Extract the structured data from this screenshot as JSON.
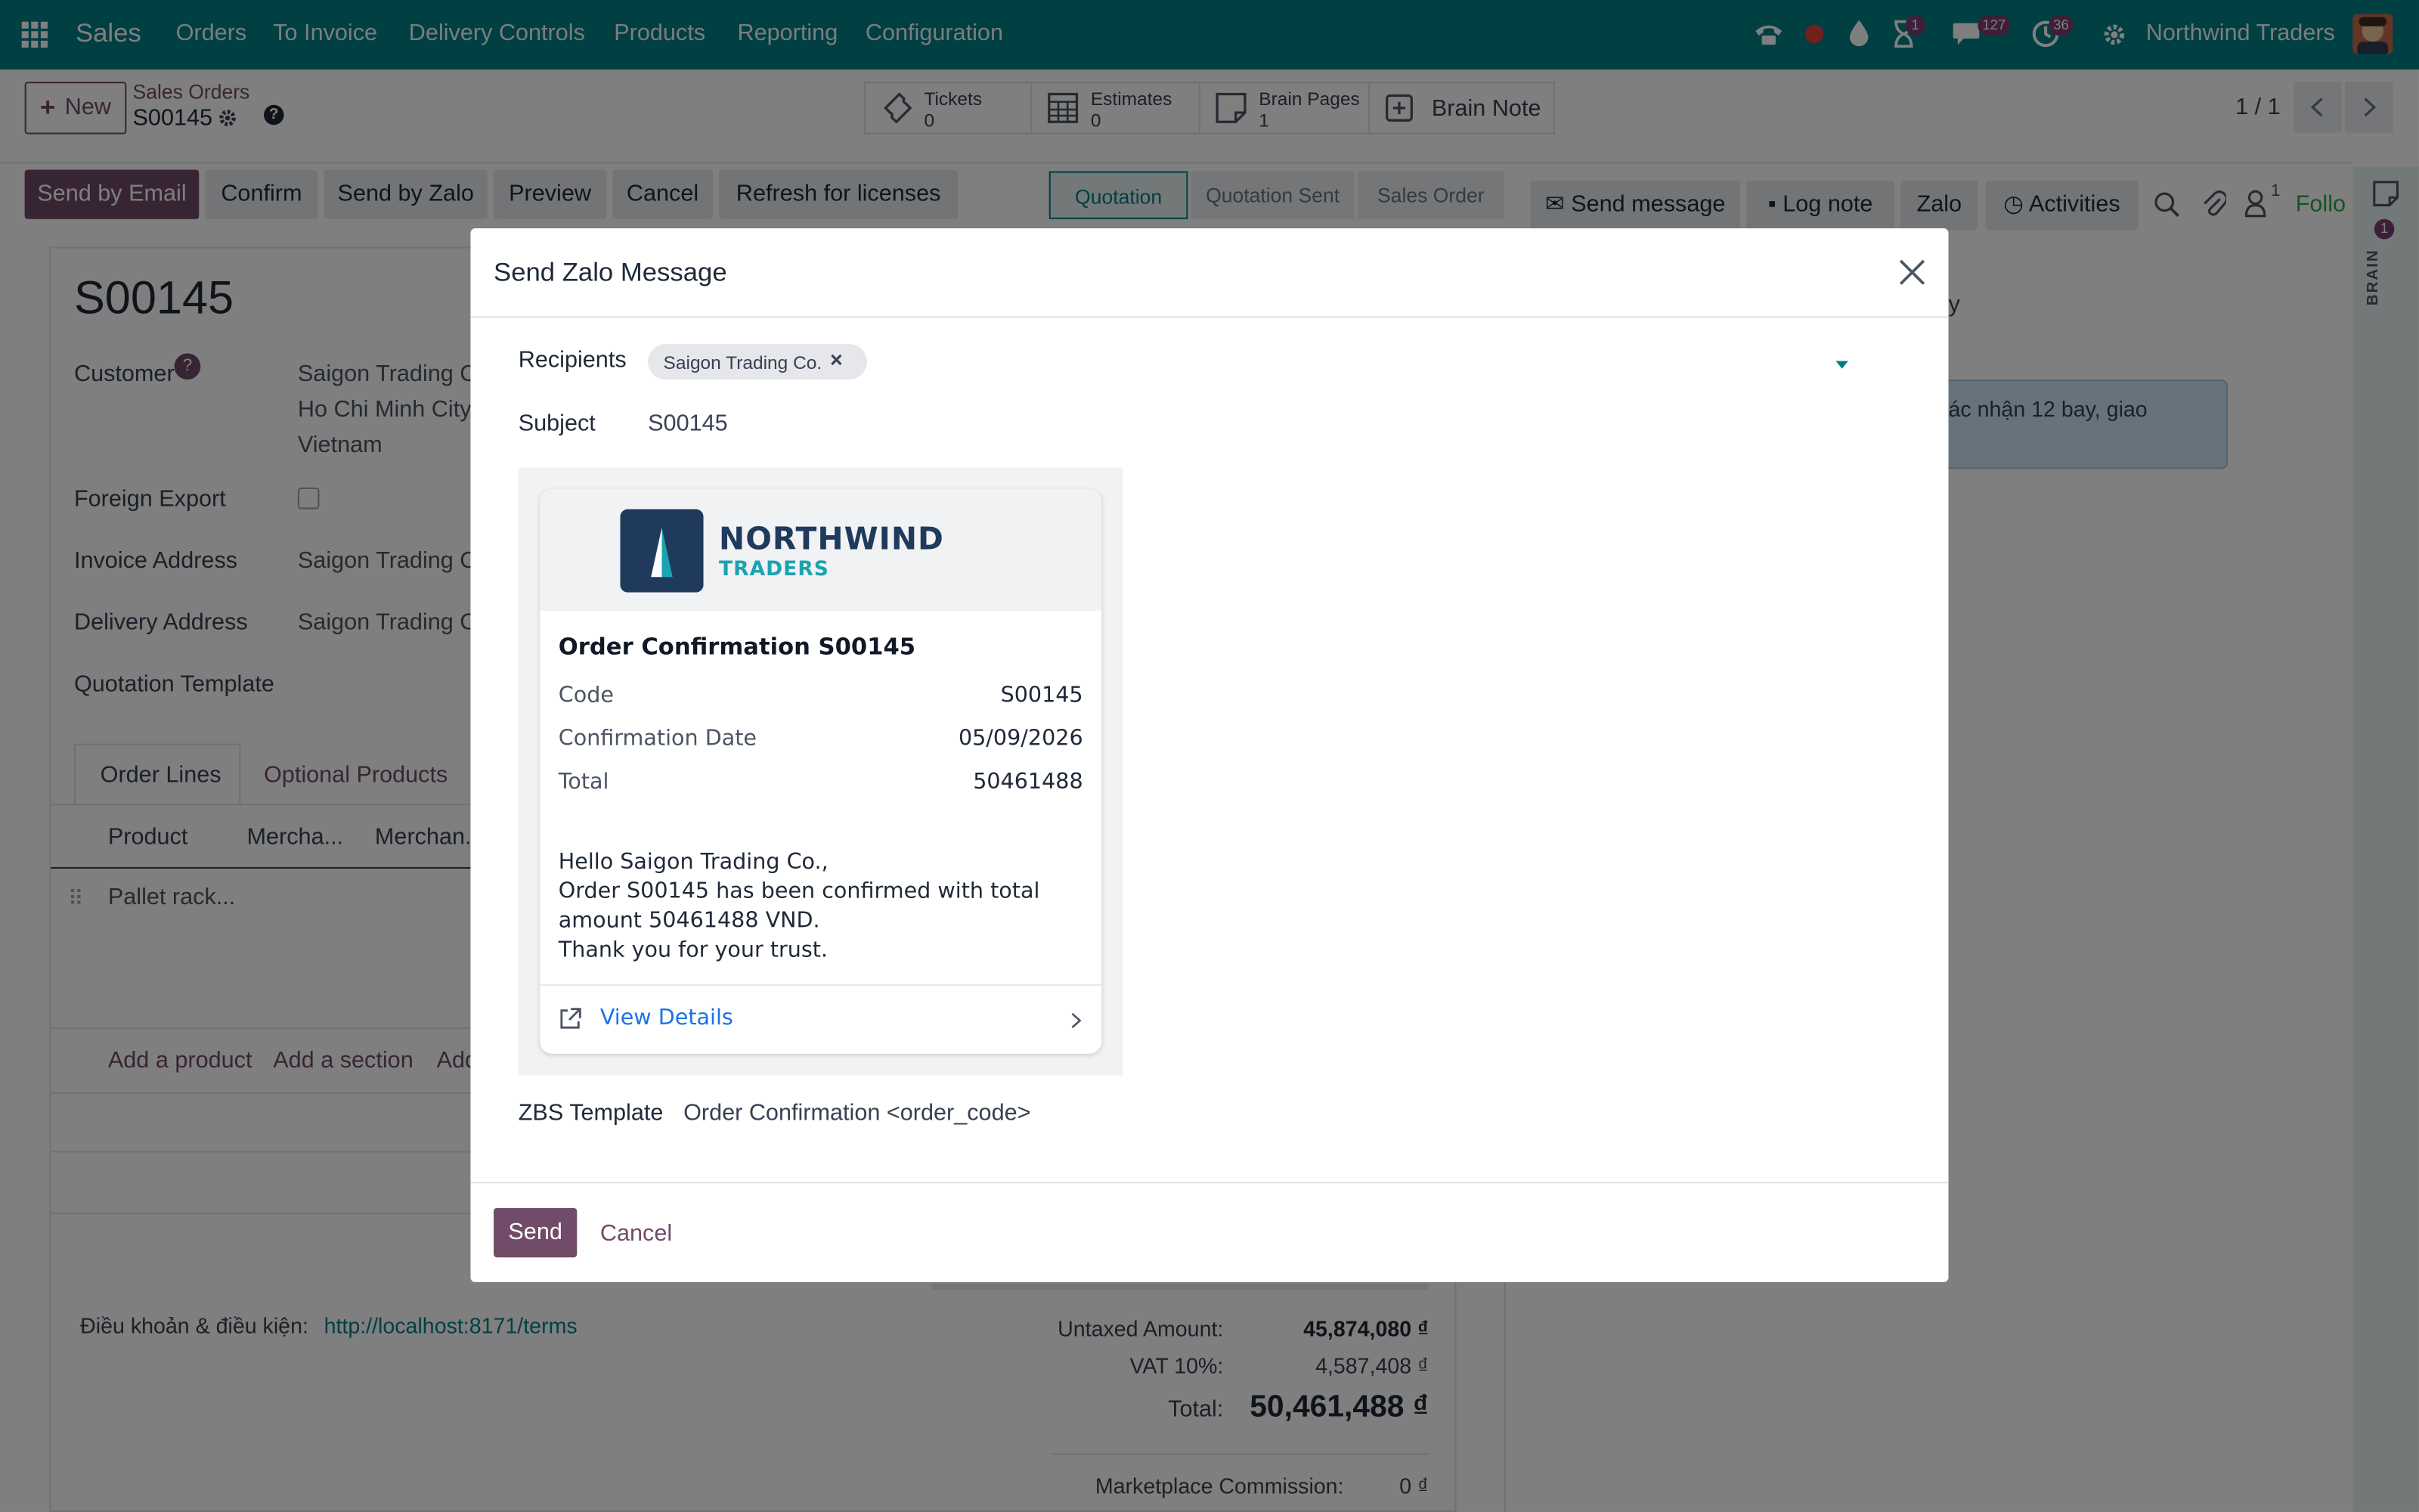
{
  "nav": {
    "app_name": "Sales",
    "menu": [
      "Orders",
      "To Invoice",
      "Delivery Controls",
      "Products",
      "Reporting",
      "Configuration"
    ],
    "badge_activity": "1",
    "badge_messages": "127",
    "badge_updates": "36",
    "company": "Northwind Traders"
  },
  "control": {
    "new_label": "New",
    "breadcrumb_parent": "Sales Orders",
    "breadcrumb_current": "S00145",
    "pager": "1 / 1",
    "stats": [
      {
        "label": "Tickets",
        "value": "0"
      },
      {
        "label": "Estimates",
        "value": "0"
      },
      {
        "label": "Brain Pages",
        "value": "1"
      },
      {
        "label": "Brain Note",
        "value": ""
      }
    ]
  },
  "actions": [
    "Send by Email",
    "Confirm",
    "Send by Zalo",
    "Preview",
    "Cancel",
    "Refresh for licenses"
  ],
  "stages": [
    "Quotation",
    "Quotation Sent",
    "Sales Order"
  ],
  "chatter": {
    "send_message": "Send message",
    "log_note": "Log note",
    "zalo": "Zalo",
    "activities": "Activities",
    "followers_count": "1",
    "follow": "Follo",
    "partial_y": "y",
    "note_text": "ác nhận 12 bay, giao"
  },
  "side_panel": {
    "count": "1",
    "label": "BRAIN"
  },
  "form": {
    "name": "S00145",
    "customer_label": "Customer",
    "customer_help": "?",
    "customer_lines": [
      "Saigon Trading C",
      "Ho Chi Minh City",
      "Vietnam"
    ],
    "foreign_export_label": "Foreign Export",
    "invoice_address_label": "Invoice Address",
    "invoice_address": "Saigon Trading C",
    "delivery_address_label": "Delivery Address",
    "delivery_address": "Saigon Trading C",
    "quotation_template_label": "Quotation Template",
    "tabs": [
      "Order Lines",
      "Optional Products"
    ],
    "columns": [
      "Product",
      "Mercha...",
      "Merchan..."
    ],
    "line_product": "Pallet rack...",
    "add_links": [
      "Add a product",
      "Add a section",
      "Add"
    ],
    "terms_label": "Điều khoản & điều kiện:",
    "terms_url": "http://localhost:8171/terms",
    "totals": [
      {
        "label": "Untaxed Amount:",
        "value": "45,874,080 ₫"
      },
      {
        "label": "VAT 10%:",
        "value": "4,587,408 ₫"
      },
      {
        "label": "Total:",
        "value": "50,461,488 ₫"
      },
      {
        "label": "Marketplace Commission:",
        "value": "0 ₫"
      }
    ]
  },
  "modal": {
    "title": "Send Zalo Message",
    "recipients_label": "Recipients",
    "recipient_tag": "Saigon Trading Co.",
    "subject_label": "Subject",
    "subject_value": "S00145",
    "logo_main": "NORTHWIND",
    "logo_sub": "TRADERS",
    "card_title": "Order Confirmation S00145",
    "rows": [
      {
        "label": "Code",
        "value": "S00145"
      },
      {
        "label": "Confirmation Date",
        "value": "05/09/2026"
      },
      {
        "label": "Total",
        "value": "50461488"
      }
    ],
    "message_lines": [
      "Hello Saigon Trading Co.,",
      "Order S00145 has been confirmed with total",
      "amount 50461488 VND.",
      "Thank you for your trust."
    ],
    "view_details": "View Details",
    "template_label": "ZBS Template",
    "template_value": "Order Confirmation <order_code>",
    "send_label": "Send",
    "cancel_label": "Cancel"
  },
  "colors": {
    "brand": "#017e84",
    "primary": "#714b67",
    "logo_navy": "#1f3a5c",
    "logo_teal": "#1aa3b0"
  }
}
